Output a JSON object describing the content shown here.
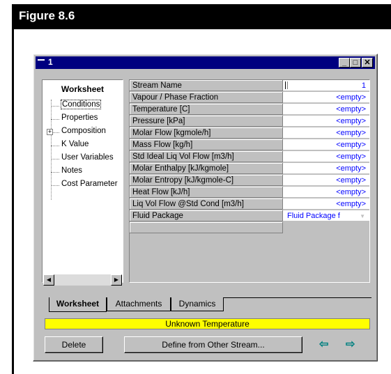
{
  "figure": {
    "title": "Figure 8.6"
  },
  "window": {
    "title": "1",
    "buttons": {
      "minimize": "_",
      "maximize": "□",
      "close": "✕"
    }
  },
  "sidebar": {
    "heading": "Worksheet",
    "items": [
      {
        "label": "Conditions",
        "selected": true
      },
      {
        "label": "Properties"
      },
      {
        "label": "Composition",
        "expandable": true
      },
      {
        "label": "K Value"
      },
      {
        "label": "User Variables"
      },
      {
        "label": "Notes"
      },
      {
        "label": "Cost Parameter"
      }
    ],
    "expander_symbol": "+"
  },
  "grid": {
    "rows": [
      {
        "label": "Stream Name",
        "value": "1"
      },
      {
        "label": "Vapour / Phase Fraction",
        "value": "<empty>"
      },
      {
        "label": "Temperature [C]",
        "value": "<empty>"
      },
      {
        "label": "Pressure [kPa]",
        "value": "<empty>"
      },
      {
        "label": "Molar Flow [kgmole/h]",
        "value": "<empty>"
      },
      {
        "label": "Mass Flow [kg/h]",
        "value": "<empty>"
      },
      {
        "label": "Std Ideal Liq Vol Flow [m3/h]",
        "value": "<empty>"
      },
      {
        "label": "Molar Enthalpy [kJ/kgmole]",
        "value": "<empty>"
      },
      {
        "label": "Molar Entropy [kJ/kgmole-C]",
        "value": "<empty>"
      },
      {
        "label": "Heat Flow [kJ/h]",
        "value": "<empty>"
      },
      {
        "label": "Liq Vol Flow @Std Cond [m3/h]",
        "value": "<empty>"
      },
      {
        "label": "Fluid Package",
        "value": "Fluid Package f"
      },
      {
        "label": "",
        "value": ""
      }
    ]
  },
  "tabs": [
    {
      "label": "Worksheet",
      "active": true
    },
    {
      "label": "Attachments"
    },
    {
      "label": "Dynamics"
    }
  ],
  "status": {
    "text": "Unknown Temperature",
    "color": "#ffff00"
  },
  "footer": {
    "delete_label": "Delete",
    "define_label": "Define from Other Stream...",
    "arrow_left": "⇦",
    "arrow_right": "⇨"
  },
  "colors": {
    "titlebar": "#000080",
    "value_text": "#0000ff",
    "arrows": "#008080"
  }
}
